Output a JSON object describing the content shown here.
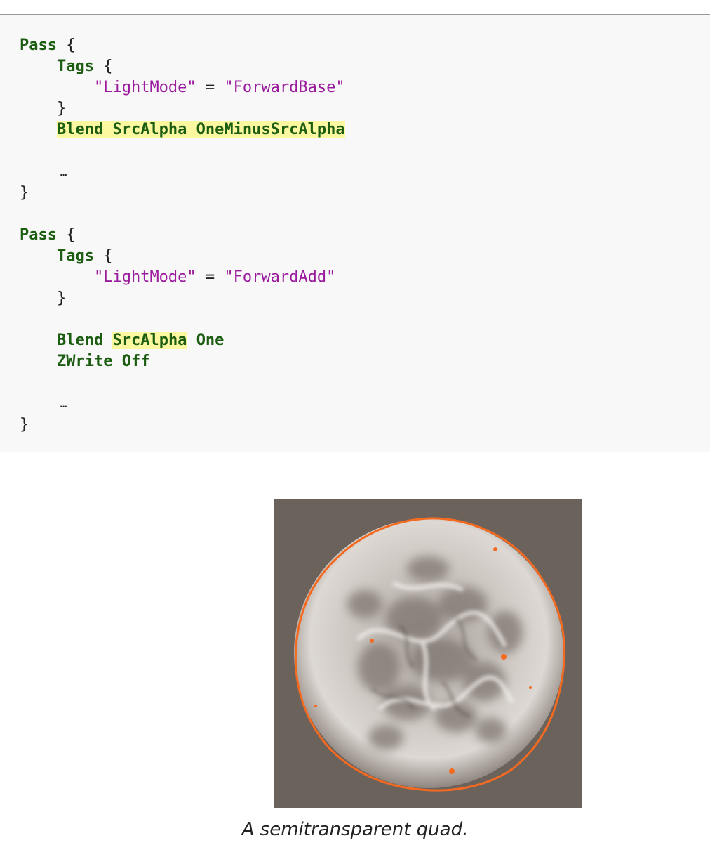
{
  "code": {
    "pass_kw": "Pass",
    "tags_kw": "Tags",
    "open_brace": "{",
    "close_brace": "}",
    "light_mode_key": "\"LightMode\"",
    "equals": "=",
    "forward_base": "\"ForwardBase\"",
    "forward_add": "\"ForwardAdd\"",
    "ellipsis": "…",
    "blend1": "Blend SrcAlpha OneMinusSrcAlpha",
    "blend2_kw": "Blend",
    "blend2_src": "SrcAlpha",
    "blend2_dst": "One",
    "zwrite": "ZWrite Off"
  },
  "figure": {
    "caption": "A semitransparent quad.",
    "background_color": "#6b625c",
    "outline_color": "#f46a21"
  }
}
